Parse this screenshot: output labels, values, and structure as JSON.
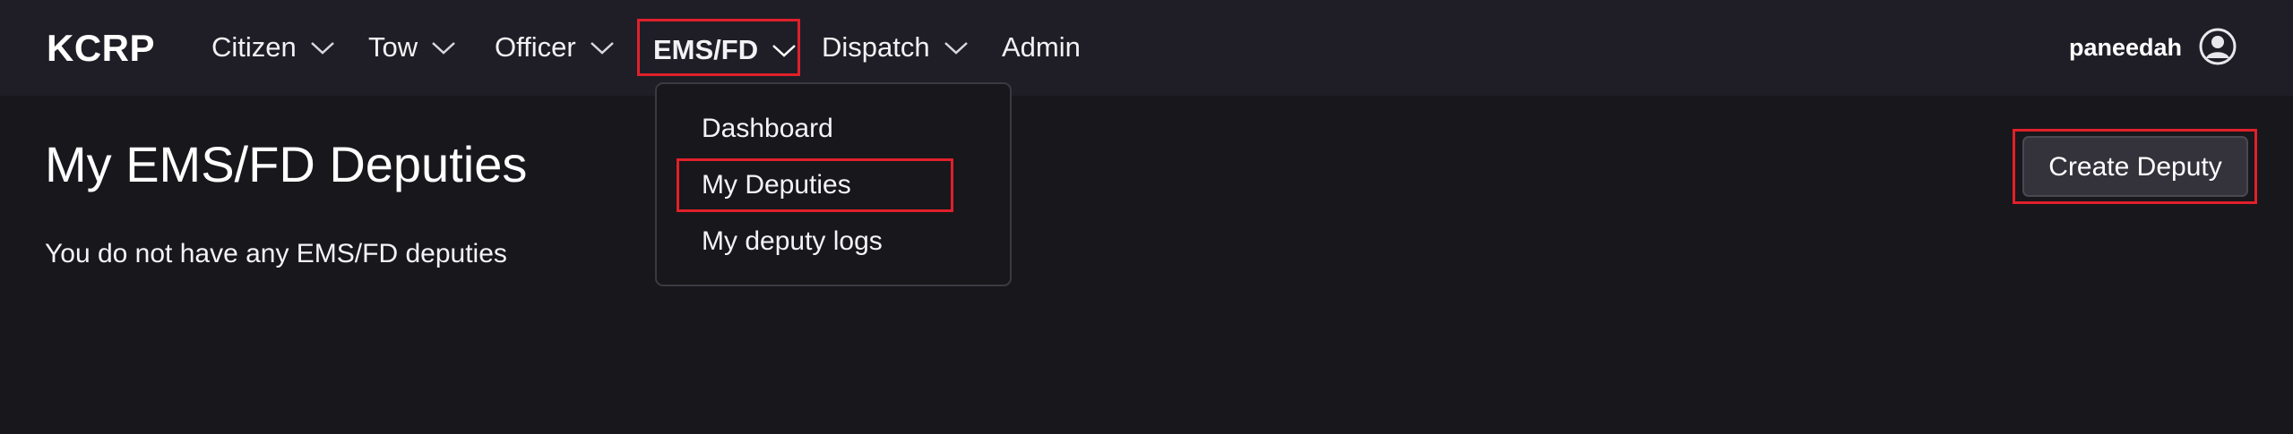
{
  "brand": "KCRP",
  "nav": {
    "items": [
      {
        "label": "Citizen"
      },
      {
        "label": "Tow"
      },
      {
        "label": "Officer"
      },
      {
        "label": "EMS/FD"
      },
      {
        "label": "Dispatch"
      },
      {
        "label": "Admin"
      }
    ]
  },
  "user": {
    "name": "paneedah"
  },
  "dropdown": {
    "items": [
      {
        "label": "Dashboard"
      },
      {
        "label": "My Deputies"
      },
      {
        "label": "My deputy logs"
      }
    ]
  },
  "page": {
    "title": "My EMS/FD Deputies",
    "empty_message": "You do not have any EMS/FD deputies",
    "create_button": "Create Deputy"
  },
  "colors": {
    "background": "#18171c",
    "navbar": "#1f1e27",
    "highlight": "#e0202a",
    "button": "#34333c"
  },
  "icons": {
    "chevron": "chevron-down-icon",
    "user": "user-circle-icon"
  }
}
